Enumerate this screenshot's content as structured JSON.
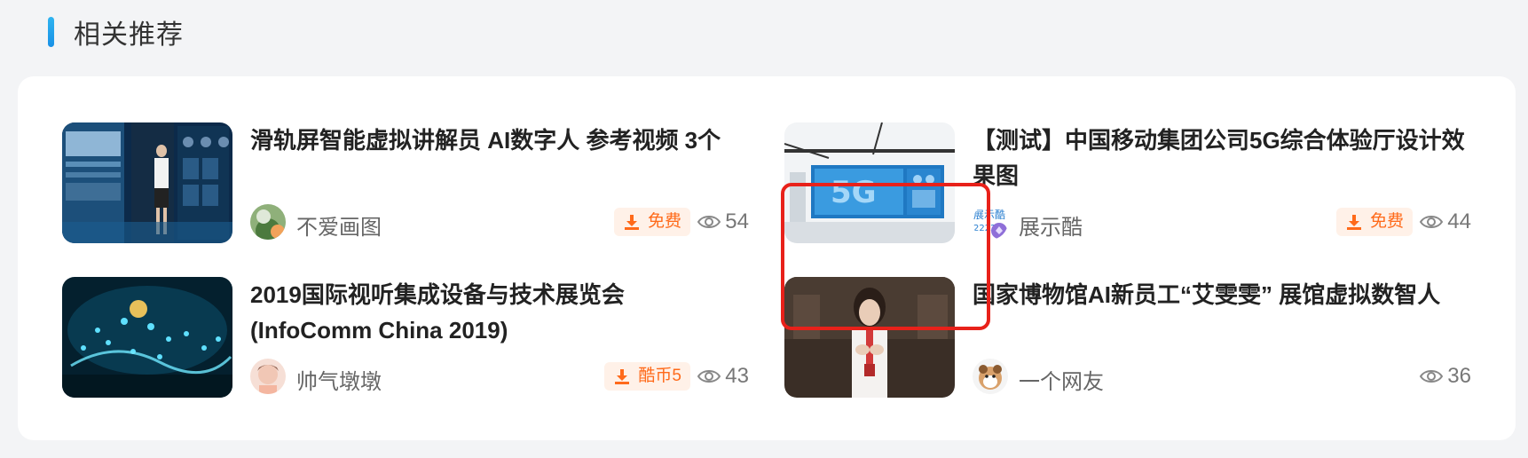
{
  "header": {
    "title": "相关推荐"
  },
  "items": [
    {
      "title": "滑轨屏智能虚拟讲解员 AI数字人 参考视频 3个",
      "author": "不爱画图",
      "badge": "免费",
      "views": "54"
    },
    {
      "title": "【测试】中国移动集团公司5G综合体验厅设计效果图",
      "author": "展示酷",
      "badge": "免费",
      "views": "44"
    },
    {
      "title": "2019国际视听集成设备与技术展览会(InfoComm China 2019)",
      "author": "帅气墩墩",
      "badge": "酷币5",
      "views": "43"
    },
    {
      "title": "国家博物馆AI新员工“艾雯雯” 展馆虚拟数智人",
      "author": "一个网友",
      "badge": "",
      "views": "36"
    }
  ],
  "colors": {
    "accent": "#1890e6",
    "badge_text": "#ff6a1a",
    "badge_bg": "#fff1e8",
    "highlight": "#e8211a"
  },
  "icons": [
    "download-icon",
    "eye-icon"
  ]
}
